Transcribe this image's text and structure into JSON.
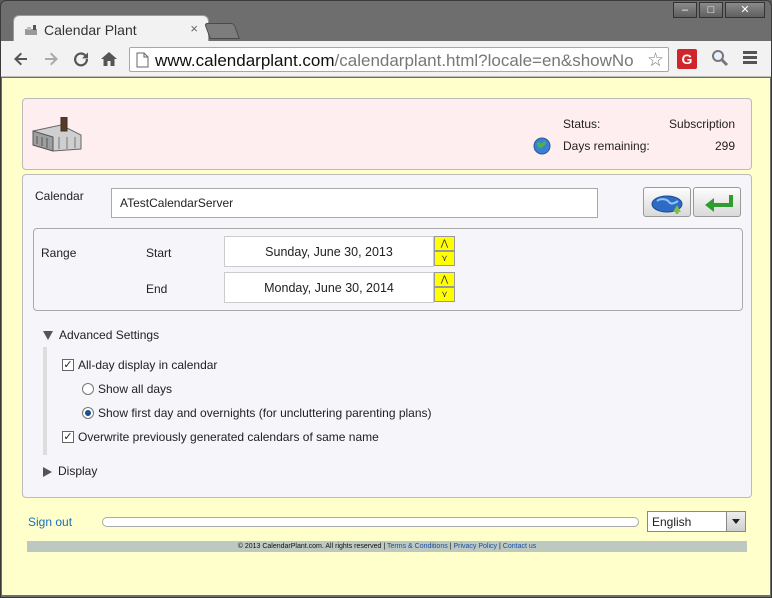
{
  "browser": {
    "tab_title": "Calendar Plant",
    "tab_close": "×",
    "url_host": "www.calendarplant.com",
    "url_path": "/calendarplant.html?locale=en&showNo",
    "window_controls": {
      "minimize": "–",
      "maximize": "□",
      "close": "✕"
    },
    "extension_label": "G"
  },
  "header": {
    "status_label": "Status:",
    "status_value": "Subscription",
    "days_label": "Days remaining:",
    "days_value": "299"
  },
  "calendar": {
    "label": "Calendar",
    "value": "ATestCalendarServer"
  },
  "range": {
    "label": "Range",
    "start_label": "Start",
    "start_value": "Sunday, June 30, 2013",
    "end_label": "End",
    "end_value": "Monday, June 30, 2014",
    "up_glyph": "⋀",
    "down_glyph": "⋎"
  },
  "advanced": {
    "label": "Advanced Settings",
    "allday_label": "All-day display in calendar",
    "allday_checked": true,
    "show_all_label": "Show all days",
    "show_first_label": "Show first day and overnights (for uncluttering parenting plans)",
    "selected_option": "show_first",
    "overwrite_label": "Overwrite previously generated calendars of same name",
    "overwrite_checked": true
  },
  "display": {
    "label": "Display"
  },
  "bottom": {
    "signout": "Sign out",
    "progress": 0,
    "language": "English"
  },
  "footer": {
    "copyright": "© 2013 CalendarPlant.com. All rights reserved",
    "sep": "|",
    "terms": "Terms & Conditions",
    "privacy": "Privacy Policy",
    "contact": "Contact us"
  },
  "icons": {
    "back": "back-arrow-icon",
    "forward": "forward-arrow-icon",
    "reload": "reload-icon",
    "home": "home-icon",
    "star": "star-icon",
    "check": "✓"
  },
  "colors": {
    "page_bg": "#ffffcc",
    "header_bg": "#ffeef0",
    "spinner_yellow": "#ffff00",
    "link": "#1a6ec0"
  }
}
